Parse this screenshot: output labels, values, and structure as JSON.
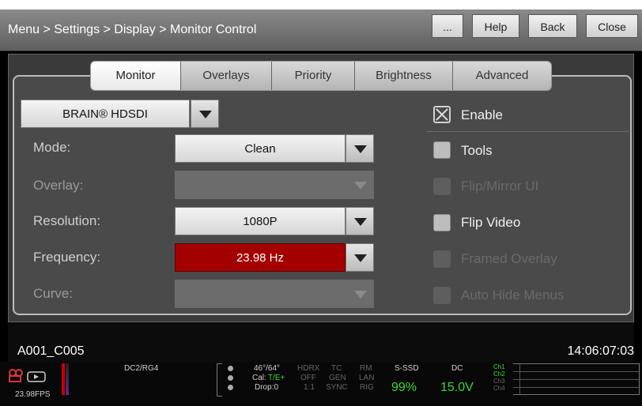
{
  "header": {
    "breadcrumb": "Menu > Settings > Display > Monitor Control",
    "buttons": [
      "...",
      "Help",
      "Back",
      "Close"
    ]
  },
  "tabs": [
    {
      "label": "Monitor",
      "active": true
    },
    {
      "label": "Overlays",
      "active": false
    },
    {
      "label": "Priority",
      "active": false
    },
    {
      "label": "Brightness",
      "active": false
    },
    {
      "label": "Advanced",
      "active": false
    }
  ],
  "monitor_select": {
    "value": "BRAIN® HDSDI"
  },
  "fields": {
    "mode": {
      "label": "Mode:",
      "value": "Clean"
    },
    "overlay": {
      "label": "Overlay:",
      "value": ""
    },
    "resolution": {
      "label": "Resolution:",
      "value": "1080P"
    },
    "frequency": {
      "label": "Frequency:",
      "value": "23.98 Hz"
    },
    "curve": {
      "label": "Curve:",
      "value": ""
    }
  },
  "options": {
    "enable": {
      "label": "Enable",
      "checked": true
    },
    "tools": {
      "label": "Tools",
      "checked": false
    },
    "flip_mirror_ui": {
      "label": "Flip/Mirror UI",
      "checked": false
    },
    "flip_video": {
      "label": "Flip Video",
      "checked": false
    },
    "framed_overlay": {
      "label": "Framed Overlay",
      "checked": false
    },
    "auto_hide_menus": {
      "label": "Auto Hide Menus",
      "checked": false
    }
  },
  "clip": {
    "name": "A001_C005",
    "timecode": "14:06:07:03"
  },
  "status": {
    "fps": "23.98FPS",
    "dc_rg": "DC2/RG4",
    "temp": "46°/64°",
    "cal_label": "Cal:",
    "cal_value": "T/E+",
    "drop": "Drop:0",
    "hdrx": "HDRX",
    "off": "OFF",
    "ratio": "1:1",
    "tc": "TC",
    "gen": "GEN",
    "sync": "SYNC",
    "rm": "RM",
    "lan": "LAN",
    "rig": "RIG",
    "ssd_label": "S-SSD",
    "ssd_value": "99%",
    "dc_label": "DC",
    "dc_value": "15.0V",
    "channels": [
      "Ch1",
      "Ch2",
      "Ch3",
      "Ch4"
    ]
  },
  "colors": {
    "frequency_bg": "#a50000",
    "status_green": "#39d839"
  }
}
